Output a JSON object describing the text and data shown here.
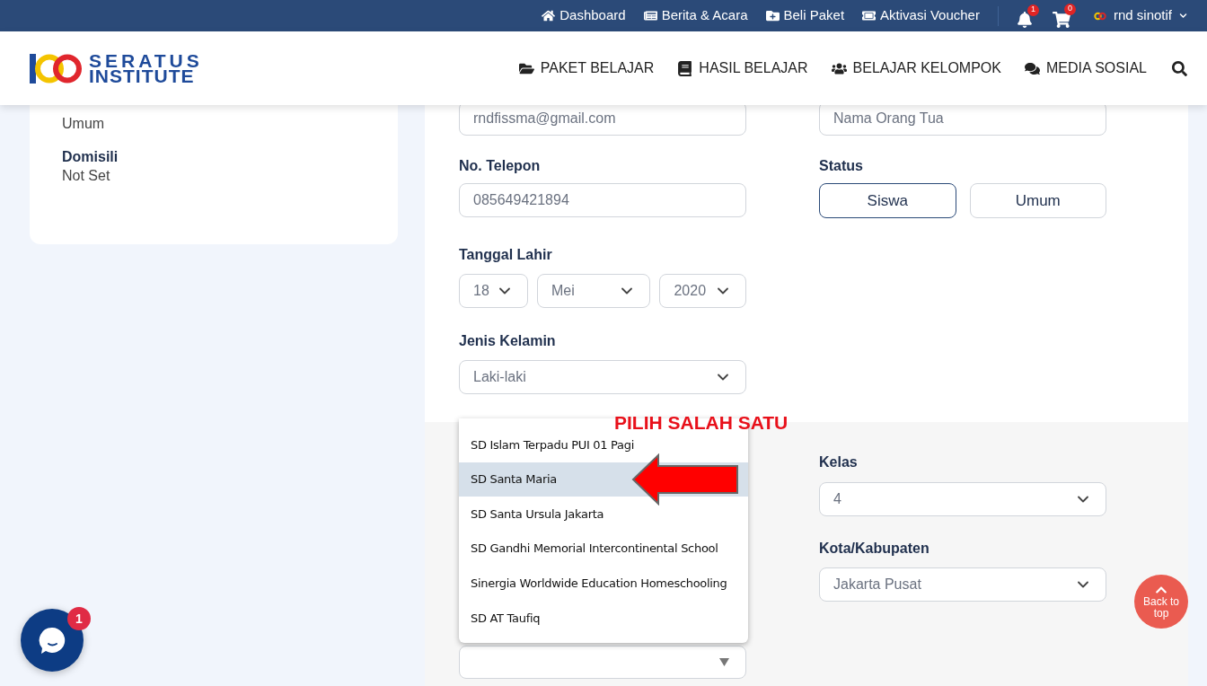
{
  "topbar": {
    "links": [
      {
        "kind": "home",
        "label": "Dashboard"
      },
      {
        "kind": "news",
        "label": "Berita & Acara"
      },
      {
        "kind": "package",
        "label": "Beli Paket"
      },
      {
        "kind": "voucher",
        "label": "Aktivasi Voucher"
      }
    ],
    "notifications": {
      "count": "1"
    },
    "cart": {
      "count": "0"
    },
    "user": {
      "name": "rnd sinotif"
    }
  },
  "header": {
    "logo": {
      "line1": "SERATUS",
      "line2": "INSTITUTE"
    },
    "nav": [
      {
        "kind": "folder",
        "label": "PAKET BELAJAR"
      },
      {
        "kind": "book",
        "label": "HASIL BELAJAR"
      },
      {
        "kind": "users",
        "label": "BELAJAR KELOMPOK"
      },
      {
        "kind": "chat",
        "label": "MEDIA SOSIAL"
      }
    ]
  },
  "profile_card": {
    "fields": [
      {
        "value": "Umum"
      },
      {
        "label": "Domisili",
        "value": "Not Set"
      }
    ]
  },
  "form": {
    "email": {
      "value": "rndfissma@gmail.com"
    },
    "parent_name": {
      "placeholder": "Nama Orang Tua"
    },
    "phone": {
      "label": "No. Telepon",
      "value": "085649421894"
    },
    "status": {
      "label": "Status",
      "options": [
        {
          "label": "Siswa",
          "selected": true
        },
        {
          "label": "Umum",
          "selected": false
        }
      ]
    },
    "birth_date": {
      "label": "Tanggal Lahir",
      "day": "18",
      "month": "Mei",
      "year": "2020"
    },
    "gender": {
      "label": "Jenis Kelamin",
      "value": "Laki-laki"
    },
    "class": {
      "label": "Kelas",
      "value": "4"
    },
    "city": {
      "label": "Kota/Kabupaten",
      "value": "Jakarta Pusat"
    },
    "school": {
      "expanded": true,
      "options": [
        {
          "label": "SD Islam Terpadu PUI 01 Pagi",
          "selected": false
        },
        {
          "label": "SD Santa Maria",
          "selected": true
        },
        {
          "label": "SD Santa Ursula Jakarta",
          "selected": false
        },
        {
          "label": "SD Gandhi Memorial Intercontinental School",
          "selected": false
        },
        {
          "label": "Sinergia Worldwide Education Homeschooling",
          "selected": false
        },
        {
          "label": "SD AT Taufiq",
          "selected": false
        }
      ]
    }
  },
  "annotation": {
    "text": "PILIH SALAH SATU"
  },
  "chat": {
    "badge": "1"
  },
  "back_to_top": {
    "label": "Back to top"
  }
}
